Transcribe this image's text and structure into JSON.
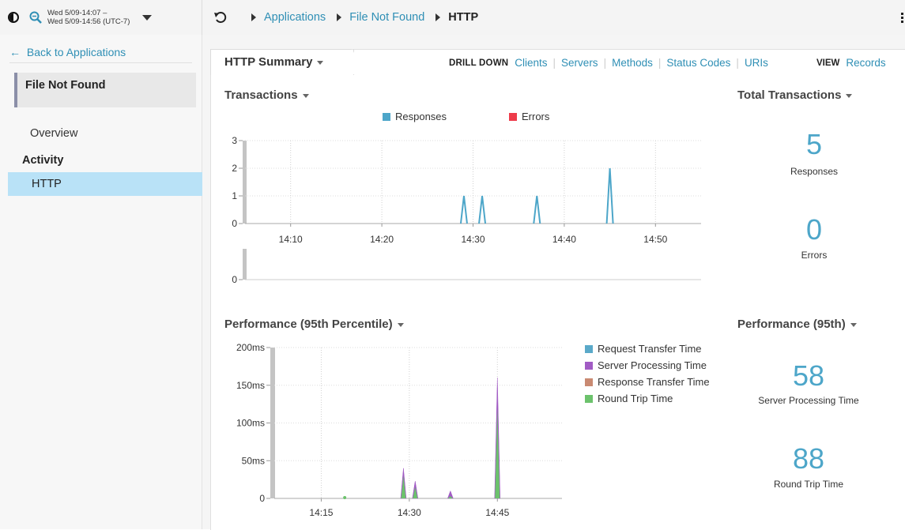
{
  "topbar": {
    "time_range_line1": "Wed 5/09-14:07 –",
    "time_range_line2": "Wed 5/09-14:56 (UTC-7)",
    "breadcrumbs": [
      "Applications",
      "File Not Found"
    ],
    "breadcrumb_current": "HTTP"
  },
  "sidebar": {
    "back_label": "Back to Applications",
    "app_name": "File Not Found",
    "overview_label": "Overview",
    "activity_heading": "Activity",
    "http_label": "HTTP"
  },
  "tabs": {
    "summary_label": "HTTP Summary",
    "drilldown_caption": "DRILL DOWN",
    "drilldown_links": [
      "Clients",
      "Servers",
      "Methods",
      "Status Codes",
      "URIs"
    ],
    "view_caption": "VIEW",
    "view_link": "Records"
  },
  "transactions": {
    "title": "Transactions",
    "legend": [
      {
        "label": "Responses",
        "color": "#4da6c9"
      },
      {
        "label": "Errors",
        "color": "#ee3b4a"
      }
    ]
  },
  "totals": {
    "title": "Total Transactions",
    "responses_value": "5",
    "responses_label": "Responses",
    "errors_value": "0",
    "errors_label": "Errors"
  },
  "performance": {
    "title": "Performance (95th Percentile)",
    "legend": [
      {
        "label": "Request Transfer Time",
        "color": "#5aa9c9"
      },
      {
        "label": "Server Processing Time",
        "color": "#a15bc4"
      },
      {
        "label": "Response Transfer Time",
        "color": "#c98a72"
      },
      {
        "label": "Round Trip Time",
        "color": "#6cc26c"
      }
    ]
  },
  "perf95": {
    "title": "Performance (95th)",
    "server_value": "58",
    "server_label": "Server Processing Time",
    "rtt_value": "88",
    "rtt_label": "Round Trip Time"
  },
  "chart_data": [
    {
      "type": "line",
      "title": "Transactions",
      "x_ticks": [
        "14:10",
        "14:20",
        "14:30",
        "14:40",
        "14:50"
      ],
      "y_ticks": [
        "0",
        "1",
        "2",
        "3"
      ],
      "ylim": [
        0,
        3
      ],
      "series": [
        {
          "name": "Responses",
          "color": "#4da6c9",
          "x": [
            "14:29",
            "14:31",
            "14:37",
            "14:45"
          ],
          "values": [
            1,
            1,
            1,
            2
          ]
        },
        {
          "name": "Errors",
          "color": "#ee3b4a",
          "x": [],
          "values": []
        }
      ],
      "error_axis_ticks": [
        "0"
      ]
    },
    {
      "type": "area",
      "title": "Performance (95th Percentile)",
      "x_ticks": [
        "14:15",
        "14:30",
        "14:45"
      ],
      "y_ticks": [
        "0",
        "50ms",
        "100ms",
        "150ms",
        "200ms"
      ],
      "ylim": [
        0,
        200
      ],
      "series": [
        {
          "name": "Server Processing Time",
          "color": "#a15bc4",
          "x": [
            "14:29",
            "14:31",
            "14:37",
            "14:45"
          ],
          "values": [
            40,
            23,
            10,
            160
          ]
        },
        {
          "name": "Round Trip Time",
          "color": "#6cc26c",
          "x": [
            "14:19",
            "14:29",
            "14:31",
            "14:37",
            "14:45"
          ],
          "values": [
            1,
            30,
            15,
            3,
            120
          ]
        }
      ]
    }
  ]
}
